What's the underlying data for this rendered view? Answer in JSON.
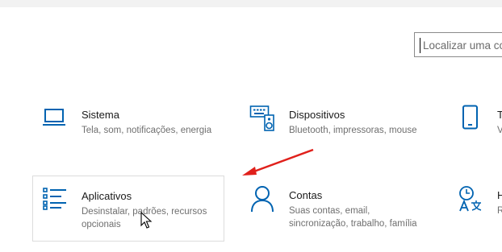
{
  "search": {
    "placeholder": "Localizar uma co"
  },
  "categories": [
    {
      "icon": "laptop-icon",
      "title": "Sistema",
      "description": "Tela, som, notificações, energia"
    },
    {
      "icon": "devices-icon",
      "title": "Dispositivos",
      "description": "Bluetooth, impressoras, mouse"
    },
    {
      "icon": "phone-icon",
      "title": "T",
      "description": "V"
    },
    {
      "icon": "apps-list-icon",
      "title": "Aplicativos",
      "description": "Desinstalar, padrões, recursos opcionais",
      "selected": true
    },
    {
      "icon": "person-icon",
      "title": "Contas",
      "description": "Suas contas, email, sincronização, trabalho, família"
    },
    {
      "icon": "time-language-icon",
      "title": "H",
      "description": "R"
    }
  ],
  "colors": {
    "accent": "#0063b1",
    "annotation_arrow": "#e0201b",
    "selected_border": "#dcdcdc"
  },
  "annotation": {
    "icon": "red-arrow-icon"
  },
  "pointer": {
    "icon": "mouse-cursor-icon"
  }
}
